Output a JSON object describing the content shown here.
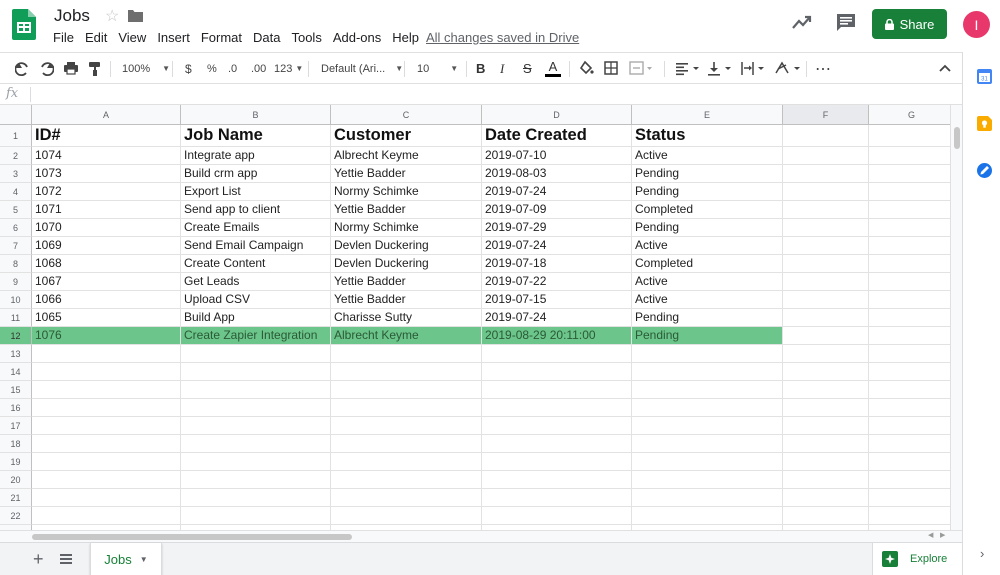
{
  "app": {
    "doc_title": "Jobs",
    "saved_status": "All changes saved in Drive",
    "share_label": "Share",
    "avatar_initial": "I",
    "menu": [
      "File",
      "Edit",
      "View",
      "Insert",
      "Format",
      "Data",
      "Tools",
      "Add-ons",
      "Help"
    ]
  },
  "toolbar": {
    "zoom": "100%",
    "currency": "$",
    "percent": "%",
    "decimal_decrease": ".0",
    "decimal_increase": ".00",
    "number_format": "123",
    "font_family": "Default (Ari...",
    "font_size": "10",
    "bold": "B",
    "italic": "I",
    "strikethrough": "S",
    "text_color": "A",
    "more": "⋯"
  },
  "formula_bar": {
    "fx": "fx",
    "value": ""
  },
  "columns": [
    "A",
    "B",
    "C",
    "D",
    "E",
    "F",
    "G"
  ],
  "row_numbers": [
    "1",
    "2",
    "3",
    "4",
    "5",
    "6",
    "7",
    "8",
    "9",
    "10",
    "11",
    "12",
    "13",
    "14",
    "15",
    "16",
    "17",
    "18",
    "19",
    "20",
    "21",
    "22",
    "23"
  ],
  "table": {
    "headers": [
      "ID#",
      "Job Name",
      "Customer",
      "Date Created",
      "Status"
    ],
    "rows": [
      [
        "1074",
        "Integrate app",
        "Albrecht Keyme",
        "2019-07-10",
        "Active"
      ],
      [
        "1073",
        "Build crm app",
        "Yettie Badder",
        "2019-08-03",
        "Pending"
      ],
      [
        "1072",
        "Export List",
        "Normy Schimke",
        "2019-07-24",
        "Pending"
      ],
      [
        "1071",
        "Send app to client",
        "Yettie Badder",
        "2019-07-09",
        "Completed"
      ],
      [
        "1070",
        "Create Emails",
        "Normy Schimke",
        "2019-07-29",
        "Pending"
      ],
      [
        "1069",
        "Send Email Campaign",
        "Devlen Duckering",
        "2019-07-24",
        "Active"
      ],
      [
        "1068",
        "Create Content",
        "Devlen Duckering",
        "2019-07-18",
        "Completed"
      ],
      [
        "1067",
        "Get Leads",
        "Yettie Badder",
        "2019-07-22",
        "Active"
      ],
      [
        "1066",
        "Upload CSV",
        "Yettie Badder",
        "2019-07-15",
        "Active"
      ],
      [
        "1065",
        "Build App",
        "Charisse Sutty",
        "2019-07-24",
        "Pending"
      ],
      [
        "1076",
        "Create Zapier Integration",
        "Albrecht Keyme",
        "2019-08-29 20:11:00",
        "Pending"
      ]
    ],
    "highlighted_row": "12"
  },
  "sheet_tabs": [
    {
      "label": "Jobs"
    }
  ],
  "explore_label": "Explore",
  "colors": {
    "brand_green": "#188038",
    "row_highlight": "#6cc58a",
    "avatar": "#e8386b"
  }
}
